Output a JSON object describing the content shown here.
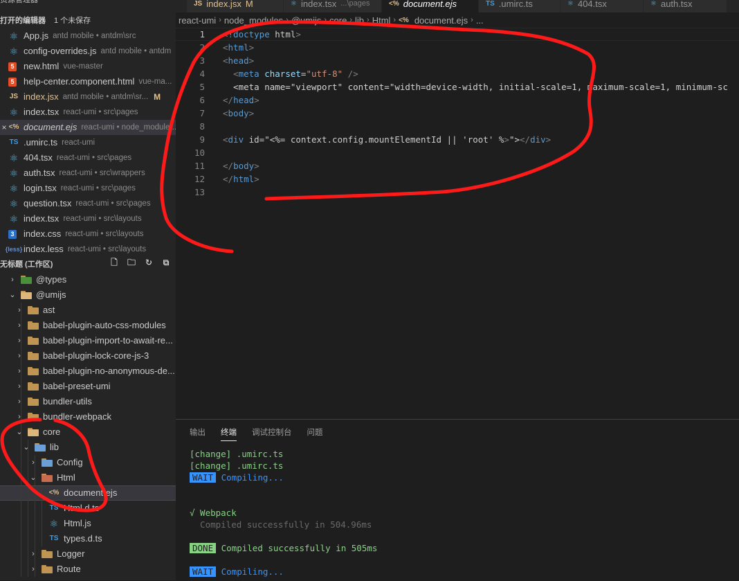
{
  "sidebar": {
    "header_title": "资源管理器",
    "open_editors": {
      "title": "打开的编辑器",
      "unsaved": "1 个未保存",
      "items": [
        {
          "icon": "react-icon",
          "name": "App.js",
          "desc": "antd mobile • antdm\\src",
          "modified": ""
        },
        {
          "icon": "react-icon",
          "name": "config-overrides.js",
          "desc": "antd mobile • antdm",
          "modified": ""
        },
        {
          "icon": "html5-icon",
          "name": "new.html",
          "desc": "vue-master",
          "modified": ""
        },
        {
          "icon": "html5-icon",
          "name": "help-center.component.html",
          "desc": "vue-ma...",
          "modified": ""
        },
        {
          "icon": "js-icon",
          "name": "index.jsx",
          "desc": "antd mobile • antdm\\sr...",
          "modified": "M"
        },
        {
          "icon": "react-icon",
          "name": "index.tsx",
          "desc": "react-umi • src\\pages",
          "modified": ""
        },
        {
          "icon": "ejs-icon",
          "name": "document.ejs",
          "desc": "react-umi • node_module...",
          "modified": "",
          "active": true
        },
        {
          "icon": "ts-icon",
          "name": ".umirc.ts",
          "desc": "react-umi",
          "modified": ""
        },
        {
          "icon": "react-icon",
          "name": "404.tsx",
          "desc": "react-umi • src\\pages",
          "modified": ""
        },
        {
          "icon": "react-icon",
          "name": "auth.tsx",
          "desc": "react-umi • src\\wrappers",
          "modified": ""
        },
        {
          "icon": "react-icon",
          "name": "login.tsx",
          "desc": "react-umi • src\\pages",
          "modified": ""
        },
        {
          "icon": "react-icon",
          "name": "question.tsx",
          "desc": "react-umi • src\\pages",
          "modified": ""
        },
        {
          "icon": "react-icon",
          "name": "index.tsx",
          "desc": "react-umi • src\\layouts",
          "modified": ""
        },
        {
          "icon": "css3-icon",
          "name": "index.css",
          "desc": "react-umi • src\\layouts",
          "modified": ""
        },
        {
          "icon": "less-icon",
          "name": "index.less",
          "desc": "react-umi • src\\layouts",
          "modified": ""
        }
      ]
    },
    "workspace_title": "无标题 (工作区)",
    "tree": [
      {
        "label": "@types",
        "depth": 1,
        "type": "folder",
        "open": false,
        "folder": "types"
      },
      {
        "label": "@umijs",
        "depth": 1,
        "type": "folder",
        "open": true,
        "folder": "open"
      },
      {
        "label": "ast",
        "depth": 2,
        "type": "folder",
        "open": false,
        "folder": "normal"
      },
      {
        "label": "babel-plugin-auto-css-modules",
        "depth": 2,
        "type": "folder",
        "open": false,
        "folder": "normal"
      },
      {
        "label": "babel-plugin-import-to-await-re...",
        "depth": 2,
        "type": "folder",
        "open": false,
        "folder": "normal"
      },
      {
        "label": "babel-plugin-lock-core-js-3",
        "depth": 2,
        "type": "folder",
        "open": false,
        "folder": "normal"
      },
      {
        "label": "babel-plugin-no-anonymous-de...",
        "depth": 2,
        "type": "folder",
        "open": false,
        "folder": "normal"
      },
      {
        "label": "babel-preset-umi",
        "depth": 2,
        "type": "folder",
        "open": false,
        "folder": "normal"
      },
      {
        "label": "bundler-utils",
        "depth": 2,
        "type": "folder",
        "open": false,
        "folder": "normal"
      },
      {
        "label": "bundler-webpack",
        "depth": 2,
        "type": "folder",
        "open": false,
        "folder": "normal"
      },
      {
        "label": "core",
        "depth": 2,
        "type": "folder",
        "open": true,
        "folder": "open"
      },
      {
        "label": "lib",
        "depth": 3,
        "type": "folder",
        "open": true,
        "folder": "lib"
      },
      {
        "label": "Config",
        "depth": 4,
        "type": "folder",
        "open": false,
        "folder": "blue"
      },
      {
        "label": "Html",
        "depth": 4,
        "type": "folder",
        "open": true,
        "folder": "red"
      },
      {
        "label": "document.ejs",
        "depth": 5,
        "type": "file",
        "icon": "ejs-icon",
        "active": true
      },
      {
        "label": "Html.d.ts",
        "depth": 5,
        "type": "file",
        "icon": "ts-icon"
      },
      {
        "label": "Html.js",
        "depth": 5,
        "type": "file",
        "icon": "react-icon"
      },
      {
        "label": "types.d.ts",
        "depth": 5,
        "type": "file",
        "icon": "ts-icon"
      },
      {
        "label": "Logger",
        "depth": 4,
        "type": "folder",
        "open": false,
        "folder": "normal"
      },
      {
        "label": "Route",
        "depth": 4,
        "type": "folder",
        "open": false,
        "folder": "normal"
      }
    ]
  },
  "tabs": [
    {
      "icon": "js-icon",
      "name": "index.jsx",
      "desc": "",
      "modified": "M",
      "active": false
    },
    {
      "icon": "react-icon",
      "name": "index.tsx",
      "desc": "...\\pages",
      "modified": "",
      "active": false
    },
    {
      "icon": "ejs-icon",
      "name": "document.ejs",
      "desc": "",
      "modified": "",
      "active": true
    },
    {
      "icon": "ts-icon",
      "name": ".umirc.ts",
      "desc": "",
      "modified": "",
      "active": false
    },
    {
      "icon": "react-icon",
      "name": "404.tsx",
      "desc": "",
      "modified": "",
      "active": false
    },
    {
      "icon": "react-icon",
      "name": "auth.tsx",
      "desc": "",
      "modified": "",
      "active": false
    }
  ],
  "breadcrumb": [
    "react-umi",
    "node_modules",
    "@umijs",
    "core",
    "lib",
    "Html",
    "document.ejs",
    "..."
  ],
  "editor": {
    "current_line": 1,
    "lines": [
      "<!doctype html>",
      "<html>",
      "<head>",
      "  <meta charset=\"utf-8\" />",
      "  <meta name=\"viewport\" content=\"width=device-width, initial-scale=1, maximum-scale=1, minimum-sc",
      "</head>",
      "<body>",
      "",
      "<div id=\"<%= context.config.mountElementId || 'root' %>\"></div>",
      "",
      "</body>",
      "</html>",
      ""
    ]
  },
  "panel": {
    "tabs": [
      {
        "label": "输出",
        "active": false
      },
      {
        "label": "终端",
        "active": true
      },
      {
        "label": "调试控制台",
        "active": false
      },
      {
        "label": "问题",
        "active": false
      }
    ],
    "terminal": {
      "change1": "[change] .umirc.ts",
      "change2": "[change] .umirc.ts",
      "wait_tag": "WAIT",
      "compiling": "Compiling...",
      "webpack": "√ Webpack",
      "compiled_time": "  Compiled successfully in 504.96ms",
      "done_tag": "DONE",
      "done_msg": "Compiled successfully in 505ms",
      "wait_tag2": "WAIT",
      "compiling2": "Compiling..."
    }
  },
  "colors": {
    "annotation": "#ff1a1a",
    "accent": "#3794ff",
    "success": "#89d185"
  }
}
